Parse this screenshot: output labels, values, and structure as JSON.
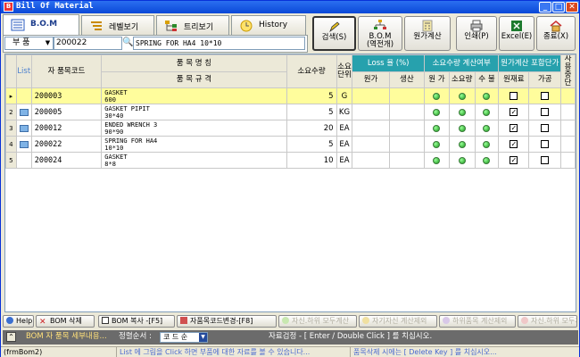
{
  "window": {
    "title": "Bill Of Material"
  },
  "tabs": [
    {
      "label": "B.O.M"
    },
    {
      "label": "레벨보기"
    },
    {
      "label": "트리보기"
    },
    {
      "label": "History"
    }
  ],
  "search": {
    "type_value": "부 품",
    "code_value": "200022",
    "name_value": "SPRING FOR HA4 10*10"
  },
  "toolbar": {
    "search": "검색(S)",
    "bom_expand": "B.O.M\n(역전개)",
    "cost_calc": "원가계산",
    "print": "인쇄(P)",
    "excel": "Excel(E)",
    "exit": "종료(X)"
  },
  "grid": {
    "headers": {
      "list": "List",
      "item_code": "자 품목코드",
      "item_name": "품  목  명  칭",
      "item_spec": "품  목  규  격",
      "qty": "소요수량",
      "unit": "소요\n단위",
      "loss_group": "Loss 율 (%)",
      "loss_cost": "원가",
      "loss_prod": "생산",
      "calc_group": "소요수량 계산여부",
      "calc_cost": "원 가",
      "calc_req": "소요량",
      "calc_num": "수 불",
      "price_group": "원가계산 포함단가",
      "price_material": "원재료",
      "price_process": "가공",
      "discontinued": "사용\n중단"
    },
    "rows": [
      {
        "ind": "▸",
        "code": "200003",
        "name": "GASKET",
        "spec": "600",
        "qty": "5",
        "unit": "G",
        "material": false,
        "process": false
      },
      {
        "ind": "2",
        "code": "200005",
        "name": "GASKET PIPIT",
        "spec": "30*40",
        "qty": "5",
        "unit": "KG",
        "material": true,
        "process": false
      },
      {
        "ind": "3",
        "code": "200012",
        "name": "ENDED WRENCH 3",
        "spec": "90*90",
        "qty": "20",
        "unit": "EA",
        "material": true,
        "process": false
      },
      {
        "ind": "4",
        "code": "200022",
        "name": "SPRING FOR HA4",
        "spec": "10*10",
        "qty": "5",
        "unit": "EA",
        "material": true,
        "process": false
      },
      {
        "ind": "5",
        "code": "200024",
        "name": "GASKET",
        "spec": "8*8",
        "qty": "10",
        "unit": "EA",
        "material": true,
        "process": false
      }
    ]
  },
  "bottom_buttons": {
    "help": "Help",
    "bom_delete": "BOM 삭제",
    "bom_copy": "BOM 복사 -[F5]",
    "child_code_change": "자품목코드변경-[F8]",
    "self_sub_all": "자신.하위 모두계산",
    "self_calc": "자기자신 계산제외",
    "sub_calc": "하위품목 계산제외",
    "self_sub_all2": "자신.하위 모두계"
  },
  "info_bar": {
    "detail": "BOM 자 품목 세부내용...",
    "sort_label": "정렬순서 :",
    "sort_value": "코 드 순",
    "hint": "자료검정 - [ Enter / Double Click ] 를 치십시오."
  },
  "status_bar": {
    "form": "(frmBom2)",
    "hint1": "List 에 그림을 Click 하면 부품에 대한 자료를 볼 수 있습니다...",
    "hint2": "품목삭제 시에는 [ Delete Key ] 를 치십시오..."
  },
  "colors": {
    "accent_header": "#27a1ad",
    "selected_row": "#fffd9c",
    "title_bar": "#0a48d8"
  }
}
